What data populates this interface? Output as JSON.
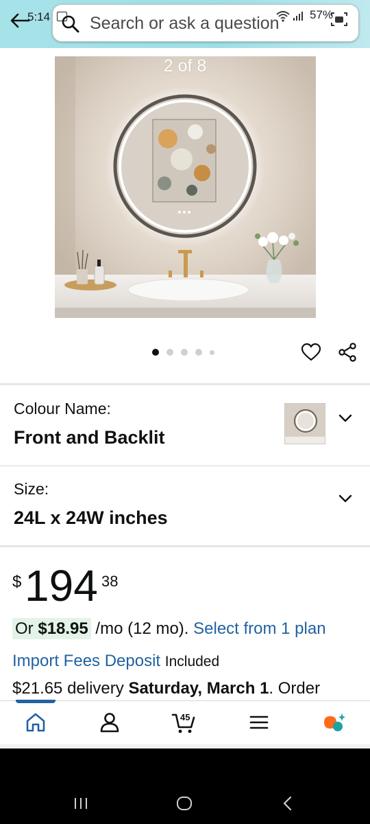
{
  "status_bar": {
    "time": "5:14",
    "battery": "57%"
  },
  "search": {
    "placeholder": "Search or ask a question"
  },
  "gallery": {
    "counter": "2 of 8",
    "dot_count": 5,
    "active_dot": 0
  },
  "variations": [
    {
      "label": "Colour Name:",
      "value": "Front and Backlit"
    },
    {
      "label": "Size:",
      "value": "24L x 24W inches"
    }
  ],
  "price": {
    "symbol": "$",
    "whole": "194",
    "fraction": "38"
  },
  "installment": {
    "prefix": "Or",
    "amount": "$18.95",
    "term": "/mo (12 mo).",
    "link": "Select from 1 plan"
  },
  "import_fees": {
    "link": "Import Fees Deposit",
    "status": "Included"
  },
  "delivery": {
    "price": "$21.65 delivery",
    "date": "Saturday, March 1",
    "suffix": ". Order"
  },
  "tabbar": {
    "items": [
      "home-icon",
      "account-icon",
      "cart-icon",
      "menu-icon",
      "rufus-icon"
    ],
    "cart_count": "45",
    "active": "home"
  },
  "colors": {
    "header_bg": "#a6e3e9",
    "link": "#2162a1",
    "installment_highlight": "#e3f3e8",
    "rufus_orange": "#ff6a1a",
    "rufus_teal": "#1aa3a3"
  }
}
